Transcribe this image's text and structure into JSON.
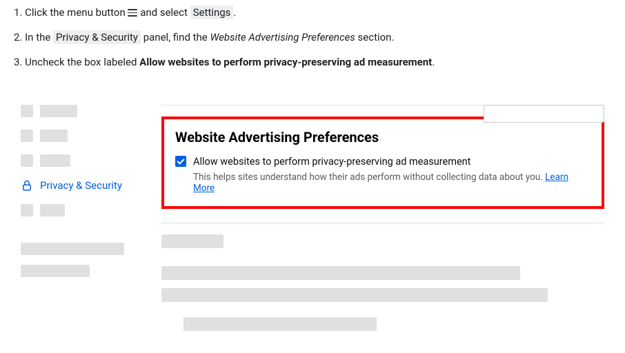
{
  "steps": {
    "s1_prefix": "1. Click the menu button ",
    "s1_mid": " and select ",
    "s1_settings": "Settings",
    "s1_suffix": ".",
    "s2_prefix": "2. In the ",
    "s2_panel": "Privacy & Security",
    "s2_mid": " panel, find the ",
    "s2_section": "Website Advertising Preferences",
    "s2_suffix": " section.",
    "s3_prefix": "3. Uncheck the box labeled ",
    "s3_label": "Allow websites to perform privacy-preserving ad measurement",
    "s3_suffix": "."
  },
  "sidebar": {
    "active_label": "Privacy & Security"
  },
  "section": {
    "title": "Website Advertising Preferences",
    "checkbox_label": "Allow websites to perform privacy-preserving ad measurement",
    "desc_prefix": "This helps sites understand how their ads perform without collecting data about you. ",
    "learn_more": "Learn More"
  }
}
